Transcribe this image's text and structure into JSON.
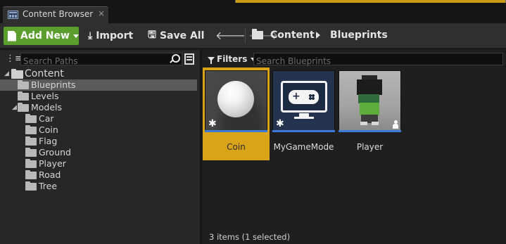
{
  "window": {
    "tab_title": "Content Browser",
    "tab_close": "×",
    "accent_color": "#c99a16"
  },
  "toolbar": {
    "add_new_label": "Add New",
    "import_label": "Import",
    "save_all_label": "Save All",
    "back_icon": "arrow-left-icon",
    "forward_icon": "arrow-right-icon",
    "breadcrumb": [
      "Content",
      "Blueprints"
    ]
  },
  "sources": {
    "search_placeholder": "Search Paths",
    "tree": [
      {
        "label": "Content",
        "level": 0,
        "expanded": true,
        "selected": false
      },
      {
        "label": "Blueprints",
        "level": 1,
        "expanded": false,
        "selected": true
      },
      {
        "label": "Levels",
        "level": 1,
        "expanded": false,
        "selected": false
      },
      {
        "label": "Models",
        "level": 1,
        "expanded": true,
        "selected": false
      },
      {
        "label": "Car",
        "level": 2,
        "selected": false
      },
      {
        "label": "Coin",
        "level": 2,
        "selected": false
      },
      {
        "label": "Flag",
        "level": 2,
        "selected": false
      },
      {
        "label": "Ground",
        "level": 2,
        "selected": false
      },
      {
        "label": "Player",
        "level": 2,
        "selected": false
      },
      {
        "label": "Road",
        "level": 2,
        "selected": false
      },
      {
        "label": "Tree",
        "level": 2,
        "selected": false
      }
    ]
  },
  "assets": {
    "filters_label": "Filters",
    "search_placeholder": "Search Blueprints",
    "items": [
      {
        "name": "Coin",
        "selected": true
      },
      {
        "name": "MyGameMode",
        "selected": false
      },
      {
        "name": "Player",
        "selected": false
      }
    ],
    "status": "3 items (1 selected)",
    "selection_color": "#d9a418",
    "blueprint_bar_color": "#3b7ad8"
  }
}
